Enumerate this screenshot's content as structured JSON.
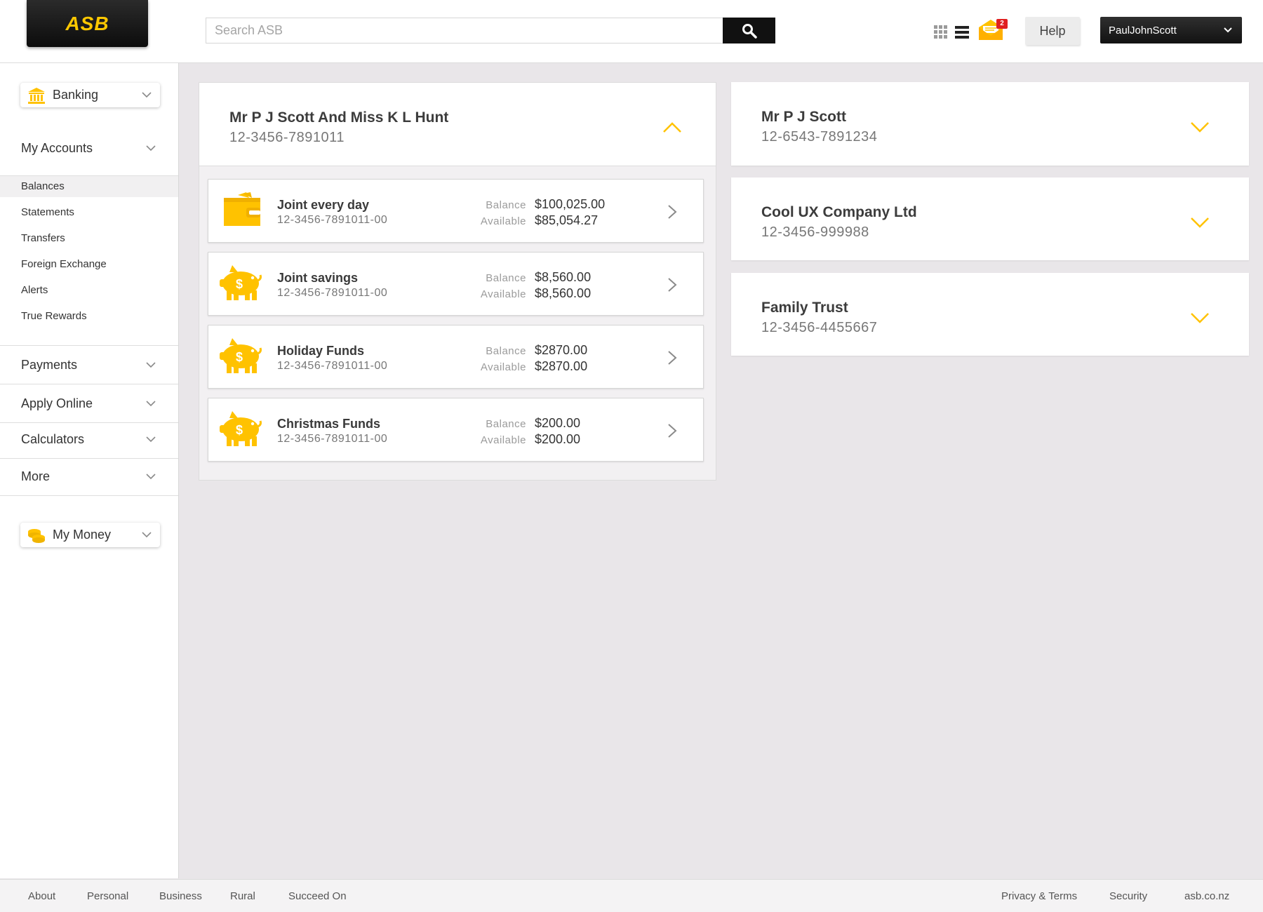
{
  "brand": {
    "logo_text": "ASB",
    "accent": "#ffc800"
  },
  "header": {
    "search_placeholder": "Search ASB",
    "mail_badge": "2",
    "help_label": "Help",
    "user_name": "PaulJohnScott"
  },
  "sidebar": {
    "banking_label": "Banking",
    "my_accounts_label": "My Accounts",
    "my_accounts_items": [
      "Balances",
      "Statements",
      "Transfers",
      "Foreign Exchange",
      "Alerts",
      "True Rewards"
    ],
    "active_item": "Balances",
    "sections": [
      "Payments",
      "Apply Online",
      "Calculators",
      "More"
    ],
    "my_money_label": "My Money"
  },
  "groups": [
    {
      "title": "Mr P J Scott And Miss K L Hunt",
      "number": "12-3456-7891011",
      "expanded": true
    },
    {
      "title": "Mr P J Scott",
      "number": "12-6543-7891234",
      "expanded": false
    },
    {
      "title": "Cool UX Company Ltd",
      "number": "12-3456-999988",
      "expanded": false
    },
    {
      "title": "Family Trust",
      "number": "12-3456-4455667",
      "expanded": false
    }
  ],
  "accounts": [
    {
      "icon": "wallet-icon",
      "name": "Joint every day",
      "number": "12-3456-7891011-00",
      "balance": "$100,025.00",
      "available": "$85,054.27"
    },
    {
      "icon": "piggy-bank-icon",
      "name": "Joint savings",
      "number": "12-3456-7891011-00",
      "balance": "$8,560.00",
      "available": "$8,560.00"
    },
    {
      "icon": "piggy-bank-icon",
      "name": "Holiday Funds",
      "number": "12-3456-7891011-00",
      "balance": "$2870.00",
      "available": "$2870.00"
    },
    {
      "icon": "piggy-bank-icon",
      "name": "Christmas Funds",
      "number": "12-3456-7891011-00",
      "balance": "$200.00",
      "available": "$200.00"
    }
  ],
  "labels": {
    "balance": "Balance",
    "available": "Available"
  },
  "footer": {
    "left_links": [
      "About",
      "Personal",
      "Business",
      "Rural",
      "Succeed On"
    ],
    "right_links": [
      "Privacy & Terms",
      "Security",
      "asb.co.nz"
    ]
  }
}
